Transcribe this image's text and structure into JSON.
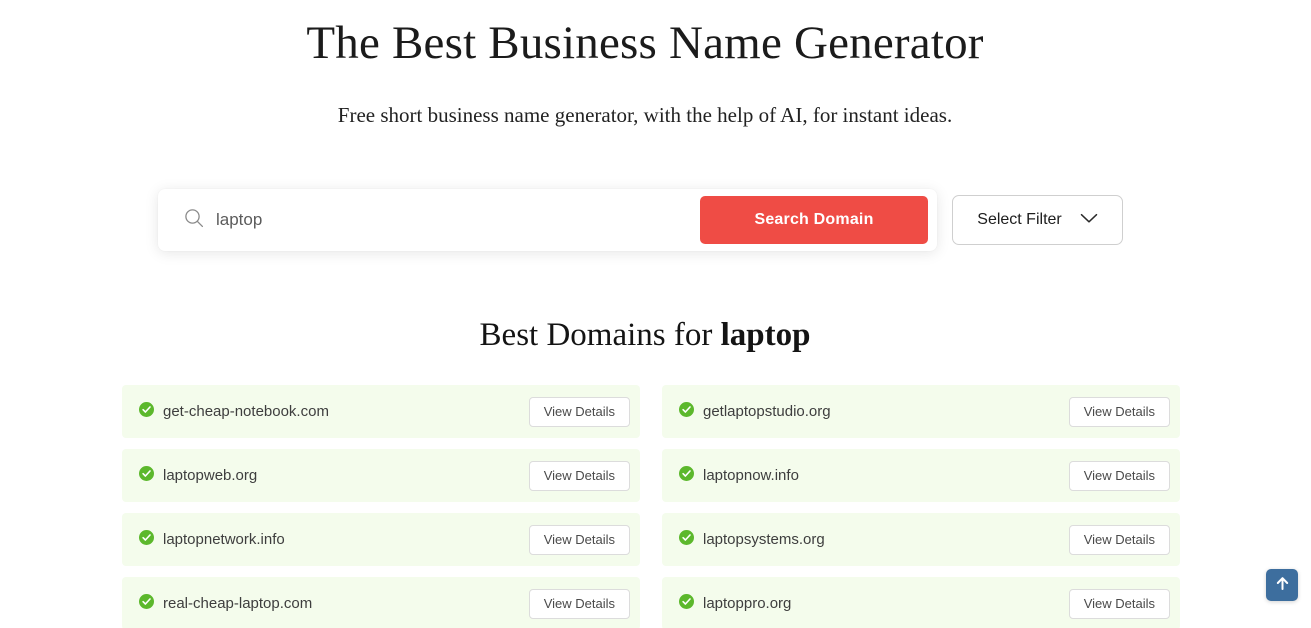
{
  "hero": {
    "title": "The Best Business Name Generator",
    "subtitle": "Free short business name generator, with the help of AI, for instant ideas."
  },
  "search": {
    "value": "laptop",
    "placeholder": "Enter a keyword",
    "search_button_label": "Search Domain",
    "filter_button_label": "Select Filter",
    "search_icon": "search-icon",
    "chevron_icon": "chevron-down-icon"
  },
  "results": {
    "heading_prefix": "Best Domains for ",
    "heading_keyword": "laptop",
    "view_details_label": "View Details",
    "status_icon": "check-circle-icon",
    "domains": [
      {
        "name": "get-cheap-notebook.com",
        "available": true
      },
      {
        "name": "getlaptopstudio.org",
        "available": true
      },
      {
        "name": "laptopweb.org",
        "available": true
      },
      {
        "name": "laptopnow.info",
        "available": true
      },
      {
        "name": "laptopnetwork.info",
        "available": true
      },
      {
        "name": "laptopsystems.org",
        "available": true
      },
      {
        "name": "real-cheap-laptop.com",
        "available": true
      },
      {
        "name": "laptoppro.org",
        "available": true
      }
    ]
  },
  "scroll_top": {
    "icon": "arrow-up-icon",
    "label": "Scroll to top"
  },
  "colors": {
    "accent_red": "#EF4C45",
    "available_green": "#5CB82C",
    "row_background": "#F4FCEC",
    "scroll_top_blue": "#3D6E9E"
  }
}
